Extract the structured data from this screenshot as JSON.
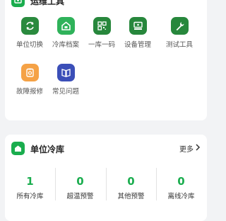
{
  "tools_section": {
    "title": "运维工具",
    "items": [
      {
        "label": "单位切换",
        "icon": "switch-icon",
        "color": "#2a8a3e"
      },
      {
        "label": "冷库档案",
        "icon": "cold-storage-archive-icon",
        "color": "#2fb25a"
      },
      {
        "label": "一库一码",
        "icon": "qr-code-icon",
        "color": "#27873c"
      },
      {
        "label": "设备管理",
        "icon": "device-icon",
        "color": "#27873c"
      },
      {
        "label": "测试工具",
        "icon": "wrench-icon",
        "color": "#27873c"
      },
      {
        "label": "故障报修",
        "icon": "repair-icon",
        "color": "#f5a246"
      },
      {
        "label": "常见问题",
        "icon": "faq-book-icon",
        "color": "#3b4fb8"
      }
    ]
  },
  "cold_section": {
    "title": "单位冷库",
    "more_label": "更多",
    "stats": [
      {
        "value": "1",
        "label": "所有冷库"
      },
      {
        "value": "0",
        "label": "超温预警"
      },
      {
        "value": "0",
        "label": "其他预警"
      },
      {
        "value": "0",
        "label": "离线冷库"
      }
    ]
  },
  "colors": {
    "accent": "#1aad4e",
    "warning": "#f5a246",
    "info": "#3b4fb8"
  }
}
